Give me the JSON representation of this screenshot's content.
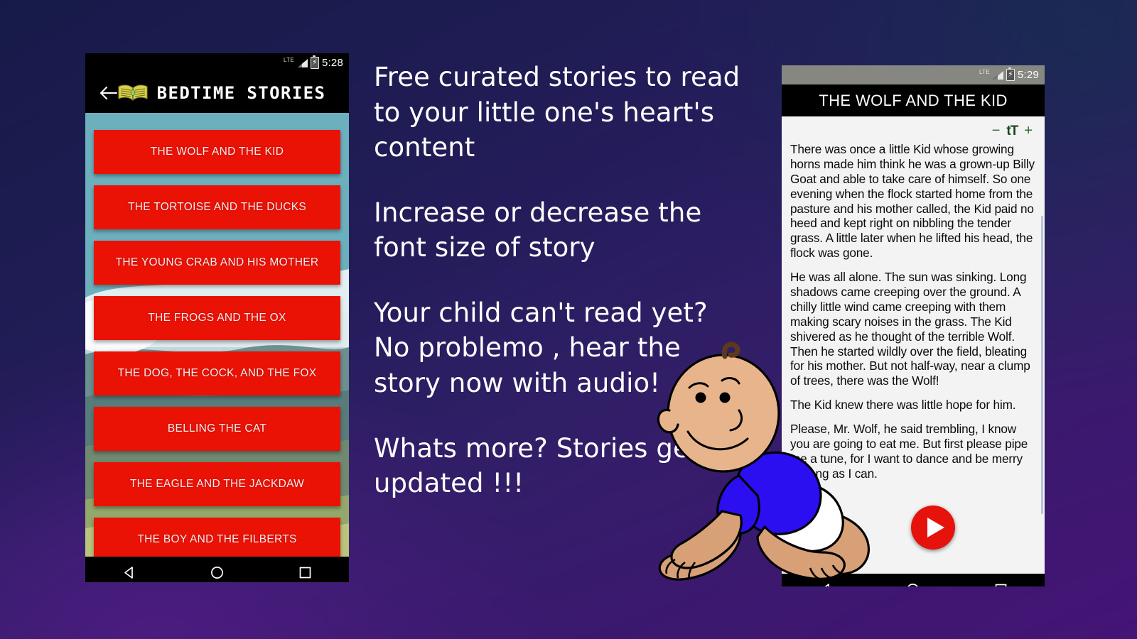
{
  "background": {
    "gradient_from": "#1b2050",
    "gradient_to": "#4b1178",
    "accent_teal": "#0e3046"
  },
  "promo": {
    "lines": [
      "Free curated stories to read to your little one's heart's content",
      "Increase or decrease the font size of story",
      "Your child can't read yet? No problemo , hear the story now with audio!",
      "Whats more? Stories get updated !!!"
    ]
  },
  "left_phone": {
    "status_bar": {
      "network": "LTE",
      "time": "5:28",
      "battery_icon": "battery-charging-icon",
      "signal_icon": "signal-bars-icon"
    },
    "app_bar": {
      "back_icon": "back-arrow-icon",
      "book_icon": "open-book-icon",
      "title": "BEDTIME  STORIES"
    },
    "list_background_color": "#6cb0be",
    "item_color": "#e91205",
    "stories": [
      "THE WOLF AND THE KID",
      "THE TORTOISE AND THE DUCKS",
      "THE YOUNG CRAB AND HIS MOTHER",
      "THE FROGS AND THE OX",
      "THE DOG, THE COCK, AND THE FOX",
      "BELLING THE CAT",
      "THE EAGLE AND THE JACKDAW",
      "THE BOY AND THE FILBERTS"
    ],
    "nav_bar": {
      "back": "nav-back-icon",
      "home": "nav-home-icon",
      "recents": "nav-recents-icon"
    }
  },
  "right_phone": {
    "status_bar": {
      "network": "LTE",
      "time": "5:29",
      "battery_icon": "battery-charging-icon",
      "signal_icon": "signal-bars-icon"
    },
    "title": "THE WOLF AND THE KID",
    "font_controls": {
      "decrease": "−",
      "label": "tT",
      "increase": "+"
    },
    "story_paragraphs": [
      "There was once a little Kid whose growing horns made him think he was a grown-up Billy Goat and able to take care of himself. So one evening when the flock started home from the pasture and his mother called, the Kid paid no heed and kept right on nibbling the tender grass. A little later when he lifted his head, the flock was gone.",
      " He was all alone. The sun was sinking. Long shadows came creeping over the ground. A chilly little wind came creeping with them making scary noises in the grass. The Kid shivered as he thought of the terrible Wolf. Then he started wildly over the field, bleating for his mother. But not half-way, near a clump of trees, there was the Wolf!",
      " The Kid knew there was little hope for him.",
      " Please, Mr. Wolf, he said trembling, I know you are going to eat me. But first please pipe me a tune, for I want to dance and be merry as long as I can."
    ],
    "play_button": "play-audio-button",
    "nav_bar": {
      "back": "nav-back-icon",
      "home": "nav-home-icon",
      "recents": "nav-recents-icon"
    }
  }
}
